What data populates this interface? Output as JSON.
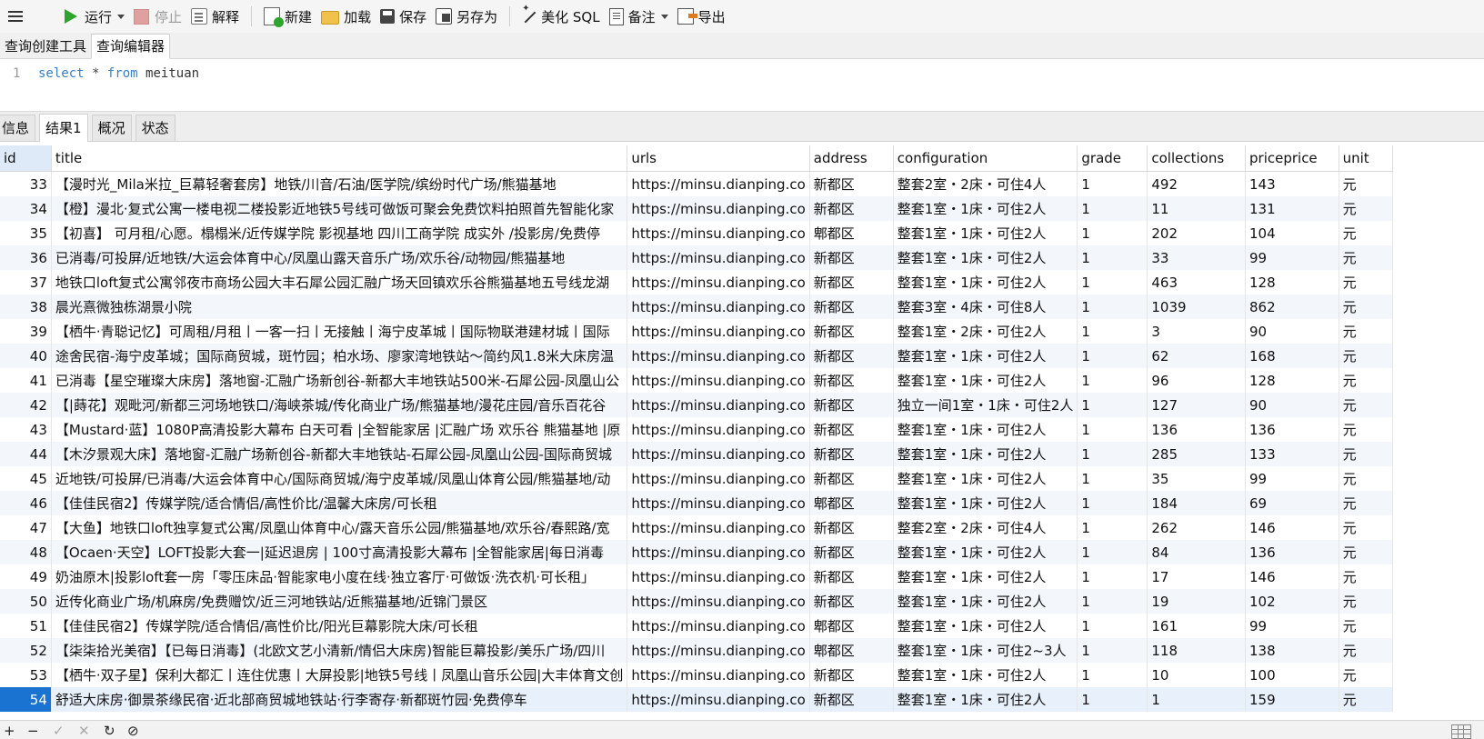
{
  "toolbar": {
    "run": "运行",
    "stop": "停止",
    "explain": "解释",
    "new": "新建",
    "load": "加载",
    "save": "保存",
    "save_as": "另存为",
    "beautify": "美化 SQL",
    "note": "备注",
    "export": "导出"
  },
  "editor_tabs": [
    "查询创建工具",
    "查询编辑器"
  ],
  "editor": {
    "line_number": "1",
    "kw_select": "select",
    "star": "*",
    "kw_from": "from",
    "table": "meituan"
  },
  "result_tabs": [
    "信息",
    "结果1",
    "概况",
    "状态"
  ],
  "grid": {
    "columns": [
      "id",
      "title",
      "urls",
      "address",
      "configuration",
      "grade",
      "collections",
      "priceprice",
      "unit"
    ],
    "rows": [
      [
        "33",
        "【漫时光_Mila米拉_巨幕轻奢套房】地铁/川音/石油/医学院/缤纷时代广场/熊猫基地",
        "https://minsu.dianping.co",
        "新都区",
        "整套2室・2床・可住4人",
        "1",
        "492",
        "143",
        "元"
      ],
      [
        "34",
        "【橙】漫北·复式公寓一楼电视二楼投影近地铁5号线可做饭可聚会免费饮料拍照首先智能化家",
        "https://minsu.dianping.co",
        "新都区",
        "整套1室・1床・可住2人",
        "1",
        "11",
        "131",
        "元"
      ],
      [
        "35",
        "【初喜】 可月租/心愿。榻榻米/近传媒学院 影视基地 四川工商学院 成实外 /投影房/免费停",
        "https://minsu.dianping.co",
        "郫都区",
        "整套1室・1床・可住2人",
        "1",
        "202",
        "104",
        "元"
      ],
      [
        "36",
        "已消毒/可投屏/近地铁/大运会体育中心/凤凰山露天音乐广场/欢乐谷/动物园/熊猫基地",
        "https://minsu.dianping.co",
        "新都区",
        "整套1室・1床・可住2人",
        "1",
        "33",
        "99",
        "元"
      ],
      [
        "37",
        "地铁口loft复式公寓邻夜市商场公园大丰石犀公园汇融广场天回镇欢乐谷熊猫基地五号线龙湖",
        "https://minsu.dianping.co",
        "新都区",
        "整套1室・1床・可住2人",
        "1",
        "463",
        "128",
        "元"
      ],
      [
        "38",
        "晨光熹微独栋湖景小院",
        "https://minsu.dianping.co",
        "新都区",
        "整套3室・4床・可住8人",
        "1",
        "1039",
        "862",
        "元"
      ],
      [
        "39",
        "【栖牛·青聪记忆】可周租/月租丨一客一扫丨无接触丨海宁皮革城丨国际物联港建材城丨国际",
        "https://minsu.dianping.co",
        "新都区",
        "整套1室・2床・可住2人",
        "1",
        "3",
        "90",
        "元"
      ],
      [
        "40",
        "途舍民宿-海宁皮革城；国际商贸城，斑竹园；柏水场、廖家湾地铁站～简约风1.8米大床房温",
        "https://minsu.dianping.co",
        "新都区",
        "整套1室・1床・可住2人",
        "1",
        "62",
        "168",
        "元"
      ],
      [
        "41",
        "已消毒【星空璀璨大床房】落地窗-汇融广场新创谷-新都大丰地铁站500米-石犀公园-凤凰山公",
        "https://minsu.dianping.co",
        "新都区",
        "整套1室・1床・可住2人",
        "1",
        "96",
        "128",
        "元"
      ],
      [
        "42",
        "【|蒔花】观毗河/新都三河场地铁口/海峡茶城/传化商业广场/熊猫基地/漫花庄园/音乐百花谷",
        "https://minsu.dianping.co",
        "新都区",
        "独立一间1室・1床・可住2人",
        "1",
        "127",
        "90",
        "元"
      ],
      [
        "43",
        "【Mustard·蓝】1080P高清投影大幕布 白天可看 |全智能家居 |汇融广场 欢乐谷 熊猫基地 |原",
        "https://minsu.dianping.co",
        "新都区",
        "整套1室・1床・可住2人",
        "1",
        "136",
        "136",
        "元"
      ],
      [
        "44",
        "【木汐景观大床】落地窗-汇融广场新创谷-新都大丰地铁站-石犀公园-凤凰山公园-国际商贸城",
        "https://minsu.dianping.co",
        "新都区",
        "整套1室・1床・可住2人",
        "1",
        "285",
        "133",
        "元"
      ],
      [
        "45",
        "近地铁/可投屏/已消毒/大运会体育中心/国际商贸城/海宁皮革城/凤凰山体育公园/熊猫基地/动",
        "https://minsu.dianping.co",
        "新都区",
        "整套1室・1床・可住2人",
        "1",
        "35",
        "99",
        "元"
      ],
      [
        "46",
        "【佳佳民宿2】传媒学院/适合情侣/高性价比/温馨大床房/可长租",
        "https://minsu.dianping.co",
        "郫都区",
        "整套1室・1床・可住2人",
        "1",
        "184",
        "69",
        "元"
      ],
      [
        "47",
        "【大鱼】地铁口loft独享复式公寓/凤凰山体育中心/露天音乐公园/熊猫基地/欢乐谷/春熙路/宽",
        "https://minsu.dianping.co",
        "新都区",
        "整套2室・2床・可住4人",
        "1",
        "262",
        "146",
        "元"
      ],
      [
        "48",
        "【Ocaen·天空】LOFT投影大套一|延迟退房 | 100寸高清投影大幕布 |全智能家居|每日消毒",
        "https://minsu.dianping.co",
        "新都区",
        "整套1室・1床・可住2人",
        "1",
        "84",
        "136",
        "元"
      ],
      [
        "49",
        "奶油原木|投影loft套一房「零压床品·智能家电小度在线·独立客厅·可做饭·洗衣机·可长租」",
        "https://minsu.dianping.co",
        "新都区",
        "整套1室・1床・可住2人",
        "1",
        "17",
        "146",
        "元"
      ],
      [
        "50",
        "近传化商业广场/机麻房/免费赠饮/近三河地铁站/近熊猫基地/近锦门景区",
        "https://minsu.dianping.co",
        "新都区",
        "整套1室・1床・可住2人",
        "1",
        "19",
        "102",
        "元"
      ],
      [
        "51",
        "【佳佳民宿2】传媒学院/适合情侣/高性价比/阳光巨幕影院大床/可长租",
        "https://minsu.dianping.co",
        "郫都区",
        "整套1室・1床・可住2人",
        "1",
        "161",
        "99",
        "元"
      ],
      [
        "52",
        "【柒柒拾光美宿】【已每日消毒】(北欧文艺小清新/情侣大床房)智能巨幕投影/美乐广场/四川",
        "https://minsu.dianping.co",
        "郫都区",
        "整套1室・1床・可住2~3人",
        "1",
        "118",
        "138",
        "元"
      ],
      [
        "53",
        "【栖牛·双子星】保利大都汇丨连住优惠丨大屏投影|地铁5号线丨凤凰山音乐公园|大丰体育文创",
        "https://minsu.dianping.co",
        "新都区",
        "整套1室・1床・可住2人",
        "1",
        "10",
        "100",
        "元"
      ],
      [
        "54",
        "舒适大床房·御景茶缘民宿·近北部商贸城地铁站·行李寄存·新都斑竹园·免费停车",
        "https://minsu.dianping.co",
        "新都区",
        "整套1室・1床・可住2人",
        "1",
        "1",
        "159",
        "元"
      ]
    ]
  },
  "bottom": {
    "add": "+",
    "remove": "−",
    "apply": "✓",
    "discard": "✕",
    "refresh": "↻",
    "stop_query": "⊘"
  }
}
